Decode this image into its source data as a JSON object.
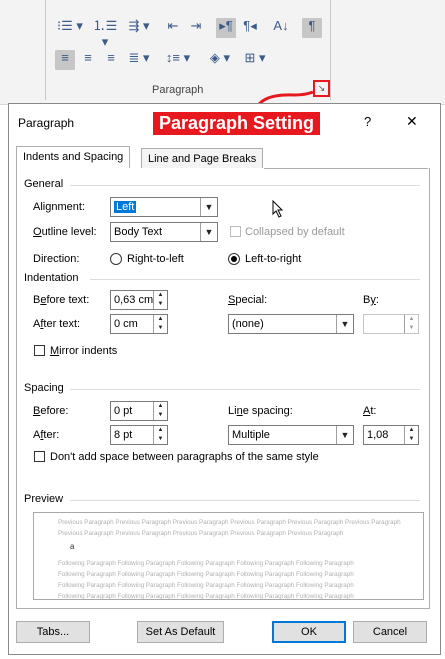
{
  "ribbon": {
    "group_label": "Paragraph",
    "row1_icons": [
      "bullets-icon",
      "numbering-icon",
      "multilevel-list-icon",
      "decrease-indent-icon",
      "increase-indent-icon",
      "ltr-paragraph-icon",
      "rtl-paragraph-icon",
      "sort-icon",
      "show-formatting-icon"
    ],
    "row2_icons": [
      "align-left-icon",
      "align-center-icon",
      "align-right-icon",
      "justify-icon",
      "line-spacing-icon",
      "shading-icon",
      "borders-icon"
    ]
  },
  "annotation": {
    "label": "Paragraph Setting",
    "color": "#e8181f"
  },
  "dialog": {
    "title": "Paragraph",
    "help": "?",
    "close": "✕",
    "tabs": [
      "Indents and Spacing",
      "Line and Page Breaks"
    ],
    "general": {
      "heading": "General",
      "alignment_label": "Alignment:",
      "alignment_value": "Left",
      "outline_label": "Outline level:",
      "outline_value": "Body Text",
      "collapsed_label": "Collapsed by default",
      "direction_label": "Direction:",
      "rtl_label": "Right-to-left",
      "ltr_label": "Left-to-right"
    },
    "indentation": {
      "heading": "Indentation",
      "before_label": "Before text:",
      "before_value": "0,63 cm",
      "after_label": "After text:",
      "after_value": "0 cm",
      "special_label": "Special:",
      "special_value": "(none)",
      "by_label": "By:",
      "by_value": "",
      "mirror_label": "Mirror indents"
    },
    "spacing": {
      "heading": "Spacing",
      "before_label": "Before:",
      "before_value": "0 pt",
      "after_label": "After:",
      "after_value": "8 pt",
      "line_label": "Line spacing:",
      "line_value": "Multiple",
      "at_label": "At:",
      "at_value": "1,08",
      "dont_add_label": "Don't add space between paragraphs of the same style"
    },
    "preview": {
      "heading": "Preview",
      "prev_line1": "Previous Paragraph Previous Paragraph Previous Paragraph Previous Paragraph Previous Paragraph Previous Paragraph",
      "prev_line2": "Previous Paragraph Previous Paragraph Previous Paragraph Previous Paragraph Previous Paragraph",
      "sample": "a",
      "follow_line1": "Following Paragraph Following Paragraph Following Paragraph Following Paragraph Following Paragraph",
      "follow_line2": "Following Paragraph Following Paragraph Following Paragraph Following Paragraph Following Paragraph",
      "follow_line3": "Following Paragraph Following Paragraph Following Paragraph Following Paragraph Following Paragraph",
      "follow_line4": "Following Paragraph Following Paragraph Following Paragraph Following Paragraph Following Paragraph"
    },
    "buttons": {
      "tabs": "Tabs...",
      "set_default": "Set As Default",
      "ok": "OK",
      "cancel": "Cancel"
    }
  }
}
